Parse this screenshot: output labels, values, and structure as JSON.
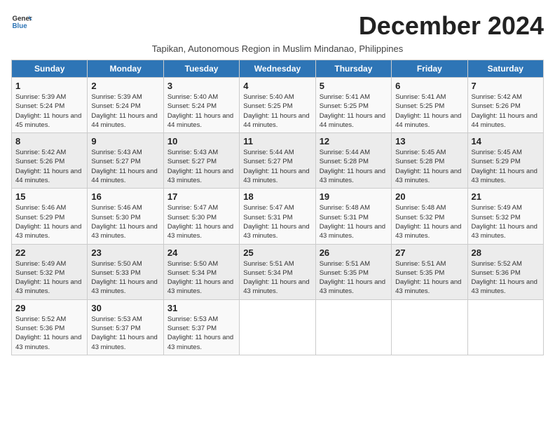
{
  "header": {
    "logo_line1": "General",
    "logo_line2": "Blue",
    "month_title": "December 2024",
    "subtitle": "Tapikan, Autonomous Region in Muslim Mindanao, Philippines"
  },
  "weekdays": [
    "Sunday",
    "Monday",
    "Tuesday",
    "Wednesday",
    "Thursday",
    "Friday",
    "Saturday"
  ],
  "weeks": [
    [
      {
        "day": "1",
        "sunrise": "5:39 AM",
        "sunset": "5:24 PM",
        "daylight": "11 hours and 45 minutes."
      },
      {
        "day": "2",
        "sunrise": "5:39 AM",
        "sunset": "5:24 PM",
        "daylight": "11 hours and 44 minutes."
      },
      {
        "day": "3",
        "sunrise": "5:40 AM",
        "sunset": "5:24 PM",
        "daylight": "11 hours and 44 minutes."
      },
      {
        "day": "4",
        "sunrise": "5:40 AM",
        "sunset": "5:25 PM",
        "daylight": "11 hours and 44 minutes."
      },
      {
        "day": "5",
        "sunrise": "5:41 AM",
        "sunset": "5:25 PM",
        "daylight": "11 hours and 44 minutes."
      },
      {
        "day": "6",
        "sunrise": "5:41 AM",
        "sunset": "5:25 PM",
        "daylight": "11 hours and 44 minutes."
      },
      {
        "day": "7",
        "sunrise": "5:42 AM",
        "sunset": "5:26 PM",
        "daylight": "11 hours and 44 minutes."
      }
    ],
    [
      {
        "day": "8",
        "sunrise": "5:42 AM",
        "sunset": "5:26 PM",
        "daylight": "11 hours and 44 minutes."
      },
      {
        "day": "9",
        "sunrise": "5:43 AM",
        "sunset": "5:27 PM",
        "daylight": "11 hours and 44 minutes."
      },
      {
        "day": "10",
        "sunrise": "5:43 AM",
        "sunset": "5:27 PM",
        "daylight": "11 hours and 43 minutes."
      },
      {
        "day": "11",
        "sunrise": "5:44 AM",
        "sunset": "5:27 PM",
        "daylight": "11 hours and 43 minutes."
      },
      {
        "day": "12",
        "sunrise": "5:44 AM",
        "sunset": "5:28 PM",
        "daylight": "11 hours and 43 minutes."
      },
      {
        "day": "13",
        "sunrise": "5:45 AM",
        "sunset": "5:28 PM",
        "daylight": "11 hours and 43 minutes."
      },
      {
        "day": "14",
        "sunrise": "5:45 AM",
        "sunset": "5:29 PM",
        "daylight": "11 hours and 43 minutes."
      }
    ],
    [
      {
        "day": "15",
        "sunrise": "5:46 AM",
        "sunset": "5:29 PM",
        "daylight": "11 hours and 43 minutes."
      },
      {
        "day": "16",
        "sunrise": "5:46 AM",
        "sunset": "5:30 PM",
        "daylight": "11 hours and 43 minutes."
      },
      {
        "day": "17",
        "sunrise": "5:47 AM",
        "sunset": "5:30 PM",
        "daylight": "11 hours and 43 minutes."
      },
      {
        "day": "18",
        "sunrise": "5:47 AM",
        "sunset": "5:31 PM",
        "daylight": "11 hours and 43 minutes."
      },
      {
        "day": "19",
        "sunrise": "5:48 AM",
        "sunset": "5:31 PM",
        "daylight": "11 hours and 43 minutes."
      },
      {
        "day": "20",
        "sunrise": "5:48 AM",
        "sunset": "5:32 PM",
        "daylight": "11 hours and 43 minutes."
      },
      {
        "day": "21",
        "sunrise": "5:49 AM",
        "sunset": "5:32 PM",
        "daylight": "11 hours and 43 minutes."
      }
    ],
    [
      {
        "day": "22",
        "sunrise": "5:49 AM",
        "sunset": "5:32 PM",
        "daylight": "11 hours and 43 minutes."
      },
      {
        "day": "23",
        "sunrise": "5:50 AM",
        "sunset": "5:33 PM",
        "daylight": "11 hours and 43 minutes."
      },
      {
        "day": "24",
        "sunrise": "5:50 AM",
        "sunset": "5:34 PM",
        "daylight": "11 hours and 43 minutes."
      },
      {
        "day": "25",
        "sunrise": "5:51 AM",
        "sunset": "5:34 PM",
        "daylight": "11 hours and 43 minutes."
      },
      {
        "day": "26",
        "sunrise": "5:51 AM",
        "sunset": "5:35 PM",
        "daylight": "11 hours and 43 minutes."
      },
      {
        "day": "27",
        "sunrise": "5:51 AM",
        "sunset": "5:35 PM",
        "daylight": "11 hours and 43 minutes."
      },
      {
        "day": "28",
        "sunrise": "5:52 AM",
        "sunset": "5:36 PM",
        "daylight": "11 hours and 43 minutes."
      }
    ],
    [
      {
        "day": "29",
        "sunrise": "5:52 AM",
        "sunset": "5:36 PM",
        "daylight": "11 hours and 43 minutes."
      },
      {
        "day": "30",
        "sunrise": "5:53 AM",
        "sunset": "5:37 PM",
        "daylight": "11 hours and 43 minutes."
      },
      {
        "day": "31",
        "sunrise": "5:53 AM",
        "sunset": "5:37 PM",
        "daylight": "11 hours and 43 minutes."
      },
      null,
      null,
      null,
      null
    ]
  ]
}
